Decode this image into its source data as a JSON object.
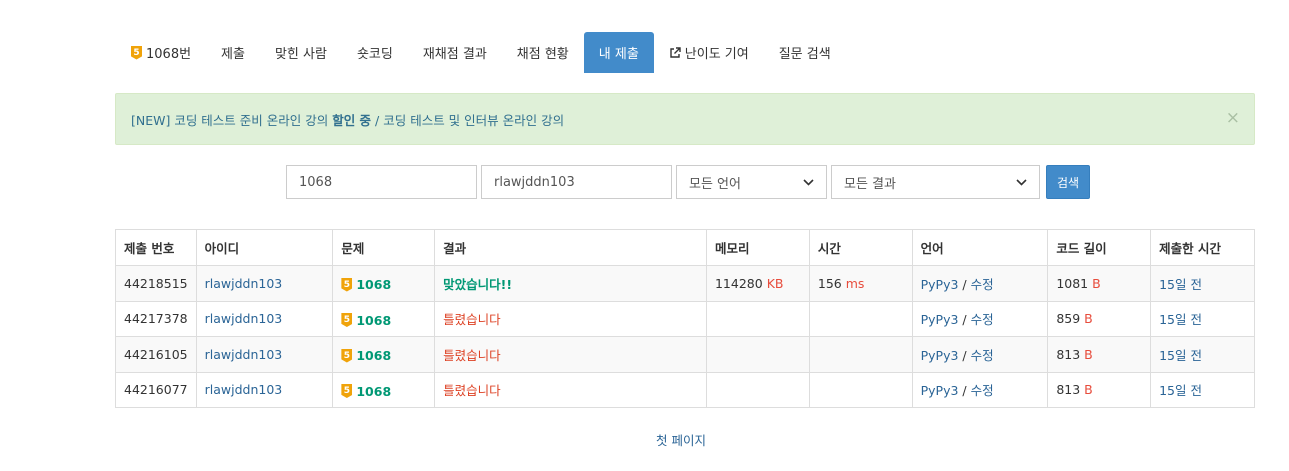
{
  "nav": {
    "problem_tier": "5",
    "items": [
      "1068번",
      "제출",
      "맞힌 사람",
      "숏코딩",
      "재채점 결과",
      "채점 현황",
      "내 제출",
      "난이도 기여",
      "질문 검색"
    ]
  },
  "alert": {
    "prefix": "[NEW] 코딩 테스트 준비 온라인 강의 ",
    "bold": "할인 중",
    "suffix": " / 코딩 테스트 및 인터뷰 온라인 강의",
    "close": "×"
  },
  "filter": {
    "problem_value": "1068",
    "user_value": "rlawjddn103",
    "language_selected": "모든 언어",
    "result_selected": "모든 결과",
    "search_label": "검색"
  },
  "table": {
    "headers": [
      "제출 번호",
      "아이디",
      "문제",
      "결과",
      "메모리",
      "시간",
      "언어",
      "코드 길이",
      "제출한 시간"
    ],
    "rows": [
      {
        "id": "44218515",
        "user": "rlawjddn103",
        "tier": "5",
        "problem": "1068",
        "result": "맞았습니다!!",
        "memory": "114280",
        "memory_unit": "KB",
        "time": "156",
        "time_unit": "ms",
        "lang": "PyPy3",
        "sep": " / ",
        "edit": "수정",
        "length": "1081",
        "length_unit": "B",
        "submitted": "15일 전"
      },
      {
        "id": "44217378",
        "user": "rlawjddn103",
        "tier": "5",
        "problem": "1068",
        "result": "틀렸습니다",
        "memory": "",
        "memory_unit": "",
        "time": "",
        "time_unit": "",
        "lang": "PyPy3",
        "sep": " / ",
        "edit": "수정",
        "length": "859",
        "length_unit": "B",
        "submitted": "15일 전"
      },
      {
        "id": "44216105",
        "user": "rlawjddn103",
        "tier": "5",
        "problem": "1068",
        "result": "틀렸습니다",
        "memory": "",
        "memory_unit": "",
        "time": "",
        "time_unit": "",
        "lang": "PyPy3",
        "sep": " / ",
        "edit": "수정",
        "length": "813",
        "length_unit": "B",
        "submitted": "15일 전"
      },
      {
        "id": "44216077",
        "user": "rlawjddn103",
        "tier": "5",
        "problem": "1068",
        "result": "틀렸습니다",
        "memory": "",
        "memory_unit": "",
        "time": "",
        "time_unit": "",
        "lang": "PyPy3",
        "sep": " / ",
        "edit": "수정",
        "length": "813",
        "length_unit": "B",
        "submitted": "15일 전"
      }
    ]
  },
  "pagination": {
    "first_page": "첫 페이지"
  }
}
